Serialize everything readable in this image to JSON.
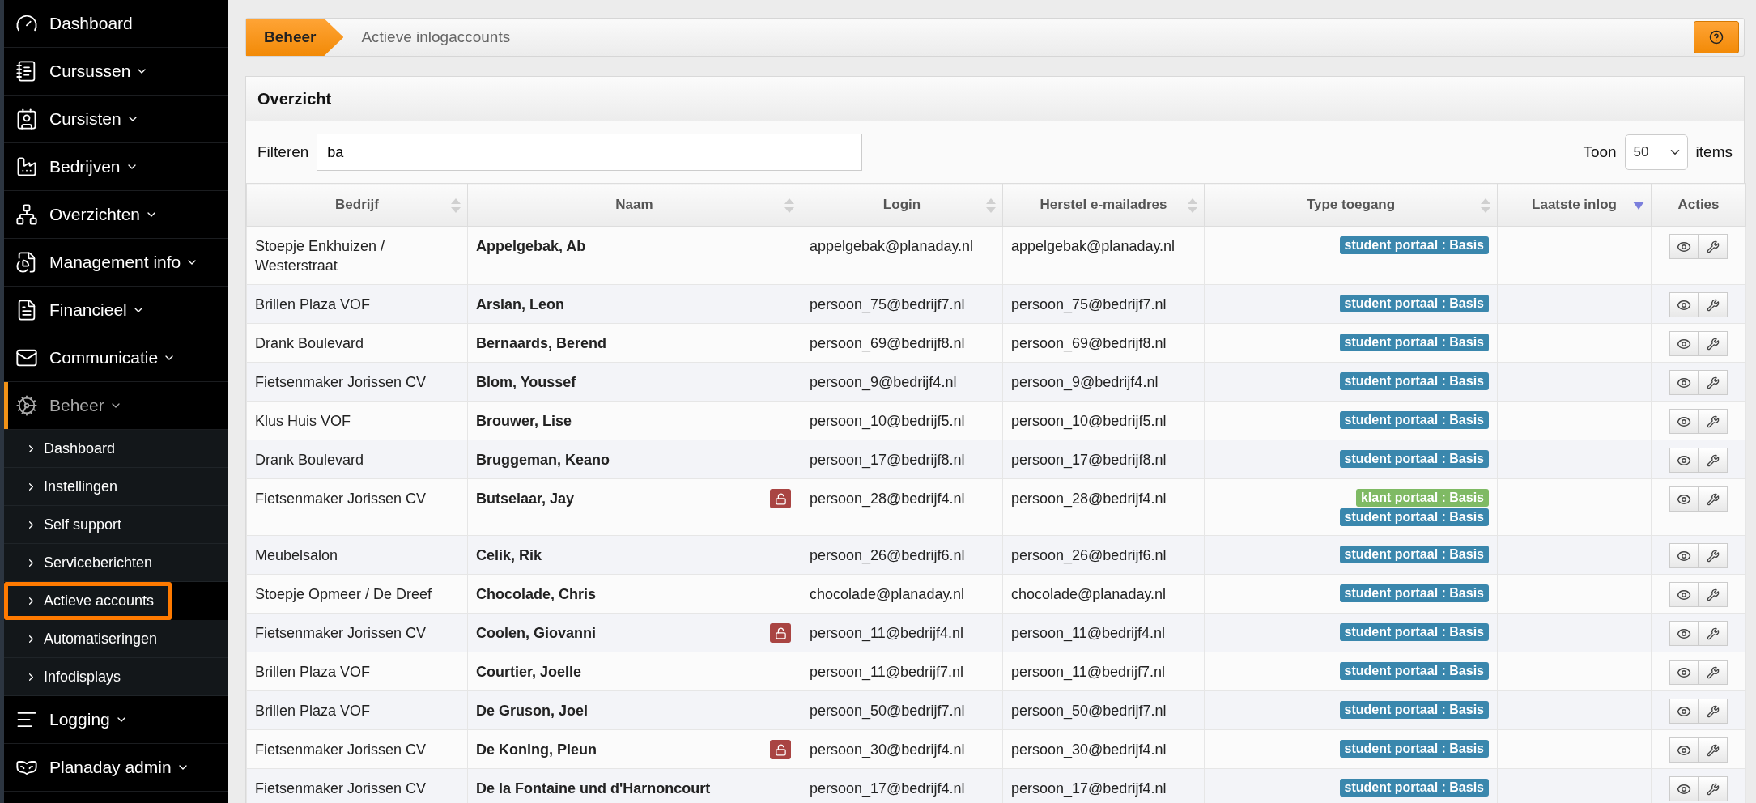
{
  "sidebar": {
    "items": [
      {
        "label": "Dashboard",
        "kind": "link",
        "selected": false
      },
      {
        "label": "Cursussen",
        "kind": "menu",
        "selected": false
      },
      {
        "label": "Cursisten",
        "kind": "menu",
        "selected": false
      },
      {
        "label": "Bedrijven",
        "kind": "menu",
        "selected": false
      },
      {
        "label": "Overzichten",
        "kind": "menu",
        "selected": false
      },
      {
        "label": "Management info",
        "kind": "menu",
        "selected": false
      },
      {
        "label": "Financieel",
        "kind": "menu",
        "selected": false
      },
      {
        "label": "Communicatie",
        "kind": "menu",
        "selected": false
      },
      {
        "label": "Beheer",
        "kind": "menu",
        "selected": true,
        "children": [
          {
            "label": "Dashboard",
            "selected": false
          },
          {
            "label": "Instellingen",
            "selected": false
          },
          {
            "label": "Self support",
            "selected": false
          },
          {
            "label": "Serviceberichten",
            "selected": false
          },
          {
            "label": "Actieve accounts",
            "selected": true
          },
          {
            "label": "Automatiseringen",
            "selected": false
          },
          {
            "label": "Infodisplays",
            "selected": false
          }
        ]
      },
      {
        "label": "Logging",
        "kind": "menu",
        "selected": false
      },
      {
        "label": "Planaday admin",
        "kind": "menu",
        "selected": false
      }
    ]
  },
  "breadcrumb": {
    "section": "Beheer",
    "page": "Actieve inlogaccounts"
  },
  "panel": {
    "title": "Overzicht",
    "filter_label": "Filteren",
    "filter_value": "ba",
    "show_label": "Toon",
    "page_size": "50",
    "items_label": "items"
  },
  "table": {
    "columns": [
      {
        "label": "Bedrijf",
        "sortable": true,
        "sorted": false
      },
      {
        "label": "Naam",
        "sortable": true,
        "sorted": false
      },
      {
        "label": "Login",
        "sortable": true,
        "sorted": false
      },
      {
        "label": "Herstel e-mailadres",
        "sortable": true,
        "sorted": false
      },
      {
        "label": "Type toegang",
        "sortable": true,
        "sorted": false
      },
      {
        "label": "Laatste inlog",
        "sortable": true,
        "sorted": true
      },
      {
        "label": "Acties",
        "sortable": false,
        "sorted": false
      }
    ],
    "rows": [
      {
        "company": "Stoepje Enkhuizen / Westerstraat",
        "name": "Appelgebak, Ab",
        "locked": false,
        "login": "appelgebak@planaday.nl",
        "recovery": "appelgebak@planaday.nl",
        "access": [
          {
            "kind": "student",
            "label": "student portaal : Basis"
          }
        ]
      },
      {
        "company": "Brillen Plaza VOF",
        "name": "Arslan, Leon",
        "locked": false,
        "login": "persoon_75@bedrijf7.nl",
        "recovery": "persoon_75@bedrijf7.nl",
        "access": [
          {
            "kind": "student",
            "label": "student portaal : Basis"
          }
        ]
      },
      {
        "company": "Drank Boulevard",
        "name": "Bernaards, Berend",
        "locked": false,
        "login": "persoon_69@bedrijf8.nl",
        "recovery": "persoon_69@bedrijf8.nl",
        "access": [
          {
            "kind": "student",
            "label": "student portaal : Basis"
          }
        ]
      },
      {
        "company": "Fietsenmaker Jorissen CV",
        "name": "Blom, Youssef",
        "locked": false,
        "login": "persoon_9@bedrijf4.nl",
        "recovery": "persoon_9@bedrijf4.nl",
        "access": [
          {
            "kind": "student",
            "label": "student portaal : Basis"
          }
        ]
      },
      {
        "company": "Klus Huis VOF",
        "name": "Brouwer, Lise",
        "locked": false,
        "login": "persoon_10@bedrijf5.nl",
        "recovery": "persoon_10@bedrijf5.nl",
        "access": [
          {
            "kind": "student",
            "label": "student portaal : Basis"
          }
        ]
      },
      {
        "company": "Drank Boulevard",
        "name": "Bruggeman, Keano",
        "locked": false,
        "login": "persoon_17@bedrijf8.nl",
        "recovery": "persoon_17@bedrijf8.nl",
        "access": [
          {
            "kind": "student",
            "label": "student portaal : Basis"
          }
        ]
      },
      {
        "company": "Fietsenmaker Jorissen CV",
        "name": "Butselaar, Jay",
        "locked": true,
        "login": "persoon_28@bedrijf4.nl",
        "recovery": "persoon_28@bedrijf4.nl",
        "access": [
          {
            "kind": "klant",
            "label": "klant portaal : Basis"
          },
          {
            "kind": "student",
            "label": "student portaal : Basis"
          }
        ]
      },
      {
        "company": "Meubelsalon",
        "name": "Celik, Rik",
        "locked": false,
        "login": "persoon_26@bedrijf6.nl",
        "recovery": "persoon_26@bedrijf6.nl",
        "access": [
          {
            "kind": "student",
            "label": "student portaal : Basis"
          }
        ]
      },
      {
        "company": "Stoepje Opmeer / De Dreef",
        "name": "Chocolade, Chris",
        "locked": false,
        "login": "chocolade@planaday.nl",
        "recovery": "chocolade@planaday.nl",
        "access": [
          {
            "kind": "student",
            "label": "student portaal : Basis"
          }
        ]
      },
      {
        "company": "Fietsenmaker Jorissen CV",
        "name": "Coolen, Giovanni",
        "locked": true,
        "login": "persoon_11@bedrijf4.nl",
        "recovery": "persoon_11@bedrijf4.nl",
        "access": [
          {
            "kind": "student",
            "label": "student portaal : Basis"
          }
        ]
      },
      {
        "company": "Brillen Plaza VOF",
        "name": "Courtier, Joelle",
        "locked": false,
        "login": "persoon_11@bedrijf7.nl",
        "recovery": "persoon_11@bedrijf7.nl",
        "access": [
          {
            "kind": "student",
            "label": "student portaal : Basis"
          }
        ]
      },
      {
        "company": "Brillen Plaza VOF",
        "name": "De Gruson, Joel",
        "locked": false,
        "login": "persoon_50@bedrijf7.nl",
        "recovery": "persoon_50@bedrijf7.nl",
        "access": [
          {
            "kind": "student",
            "label": "student portaal : Basis"
          }
        ]
      },
      {
        "company": "Fietsenmaker Jorissen CV",
        "name": "De Koning, Pleun",
        "locked": true,
        "login": "persoon_30@bedrijf4.nl",
        "recovery": "persoon_30@bedrijf4.nl",
        "access": [
          {
            "kind": "student",
            "label": "student portaal : Basis"
          }
        ]
      },
      {
        "company": "Fietsenmaker Jorissen CV",
        "name": "De la Fontaine und d'Harnoncourt",
        "locked": false,
        "login": "persoon_17@bedrijf4.nl",
        "recovery": "persoon_17@bedrijf4.nl",
        "access": [
          {
            "kind": "student",
            "label": "student portaal : Basis"
          }
        ]
      }
    ]
  }
}
